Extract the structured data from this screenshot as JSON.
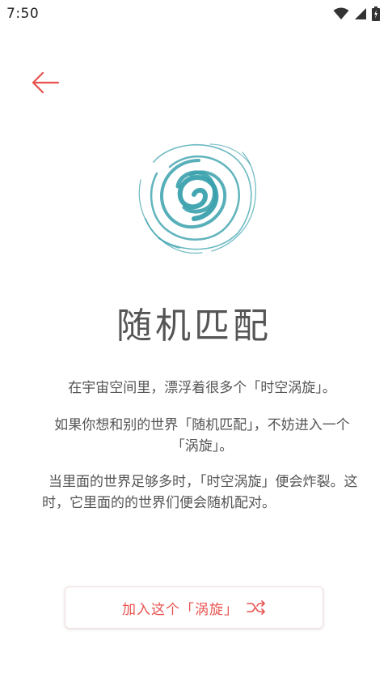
{
  "status_bar": {
    "time": "7:50",
    "icons": [
      "wifi-icon",
      "signal-icon",
      "battery-icon"
    ]
  },
  "colors": {
    "accent": "#e8524f",
    "vortex": "#3aa1ad",
    "text": "#555555"
  },
  "header": {
    "back_icon": "arrow-left-icon"
  },
  "main": {
    "logo_icon": "vortex-icon",
    "title": "随机匹配",
    "paragraphs": [
      "在宇宙空间里，漂浮着很多个「时空涡旋」。",
      "如果你想和别的世界「随机匹配」，不妨进入一个「涡旋」。",
      "当里面的世界足够多时，「时空涡旋」便会炸裂。这时，它里面的的世界们便会随机配对。"
    ]
  },
  "action": {
    "label": "加入这个「涡旋」",
    "icon": "shuffle-icon"
  }
}
